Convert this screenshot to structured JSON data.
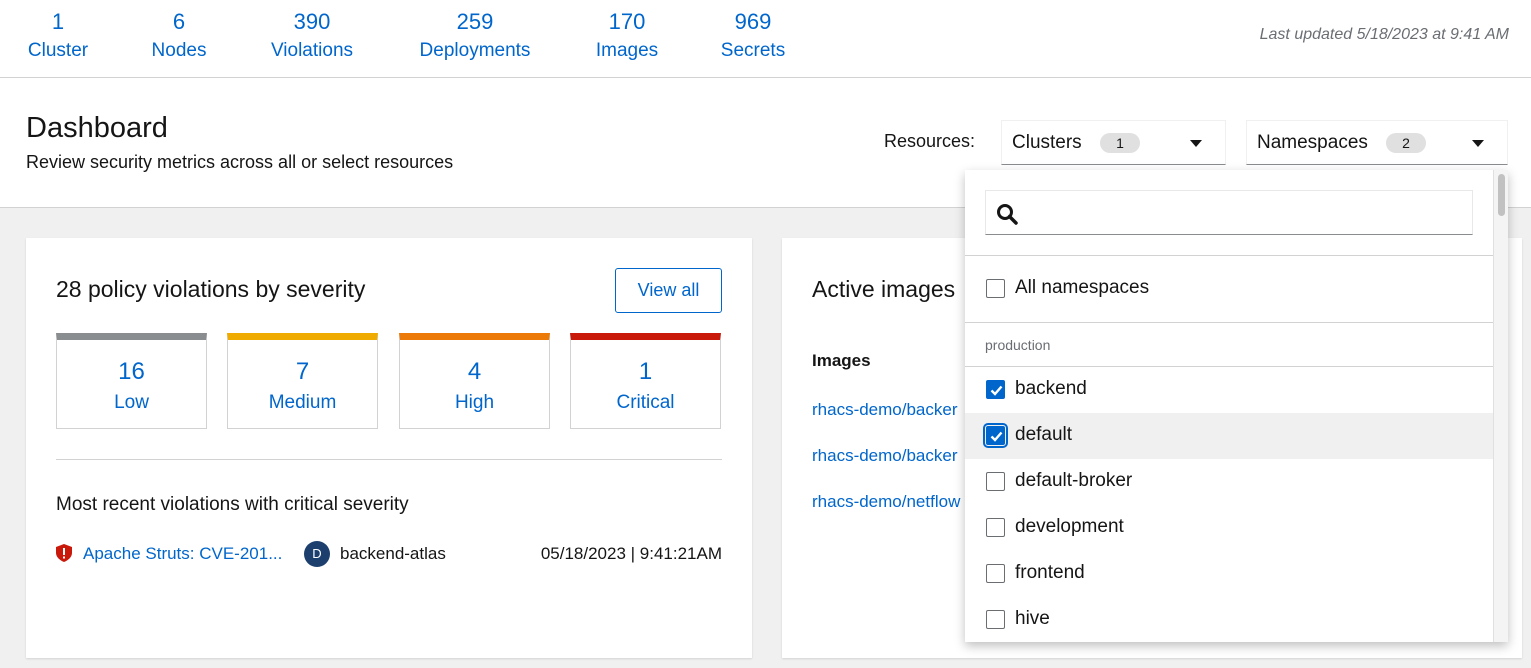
{
  "summary": {
    "stats": [
      {
        "value": "1",
        "label": "Cluster"
      },
      {
        "value": "6",
        "label": "Nodes"
      },
      {
        "value": "390",
        "label": "Violations"
      },
      {
        "value": "259",
        "label": "Deployments"
      },
      {
        "value": "170",
        "label": "Images"
      },
      {
        "value": "969",
        "label": "Secrets"
      }
    ],
    "last_updated": "Last updated 5/18/2023 at 9:41 AM"
  },
  "header": {
    "title": "Dashboard",
    "subtitle": "Review security metrics across all or select resources",
    "resources_label": "Resources:",
    "clusters_select": {
      "label": "Clusters",
      "count": "1"
    },
    "namespaces_select": {
      "label": "Namespaces",
      "count": "2"
    }
  },
  "violations_card": {
    "title": "28 policy violations by severity",
    "view_all": "View all",
    "severities": [
      {
        "count": "16",
        "label": "Low",
        "color": "#8a8d90"
      },
      {
        "count": "7",
        "label": "Medium",
        "color": "#f0ab00"
      },
      {
        "count": "4",
        "label": "High",
        "color": "#ec7a08"
      },
      {
        "count": "1",
        "label": "Critical",
        "color": "#c9190b"
      }
    ],
    "recent_title": "Most recent violations with critical severity",
    "recent": {
      "policy": "Apache Struts: CVE-201...",
      "avatar": "D",
      "deployment": "backend-atlas",
      "time": "05/18/2023 | 9:41:21AM"
    }
  },
  "images_card": {
    "title": "Active images",
    "column_header": "Images",
    "rows": [
      "rhacs-demo/backer",
      "rhacs-demo/backer",
      "rhacs-demo/netflow"
    ]
  },
  "namespace_menu": {
    "search_placeholder": "",
    "all_option": "All namespaces",
    "group": "production",
    "options": [
      {
        "label": "backend",
        "checked": true
      },
      {
        "label": "default",
        "checked": true
      },
      {
        "label": "default-broker",
        "checked": false
      },
      {
        "label": "development",
        "checked": false
      },
      {
        "label": "frontend",
        "checked": false
      },
      {
        "label": "hive",
        "checked": false
      }
    ]
  },
  "colors": {
    "accent": "#0066cc",
    "critical": "#c9190b"
  }
}
